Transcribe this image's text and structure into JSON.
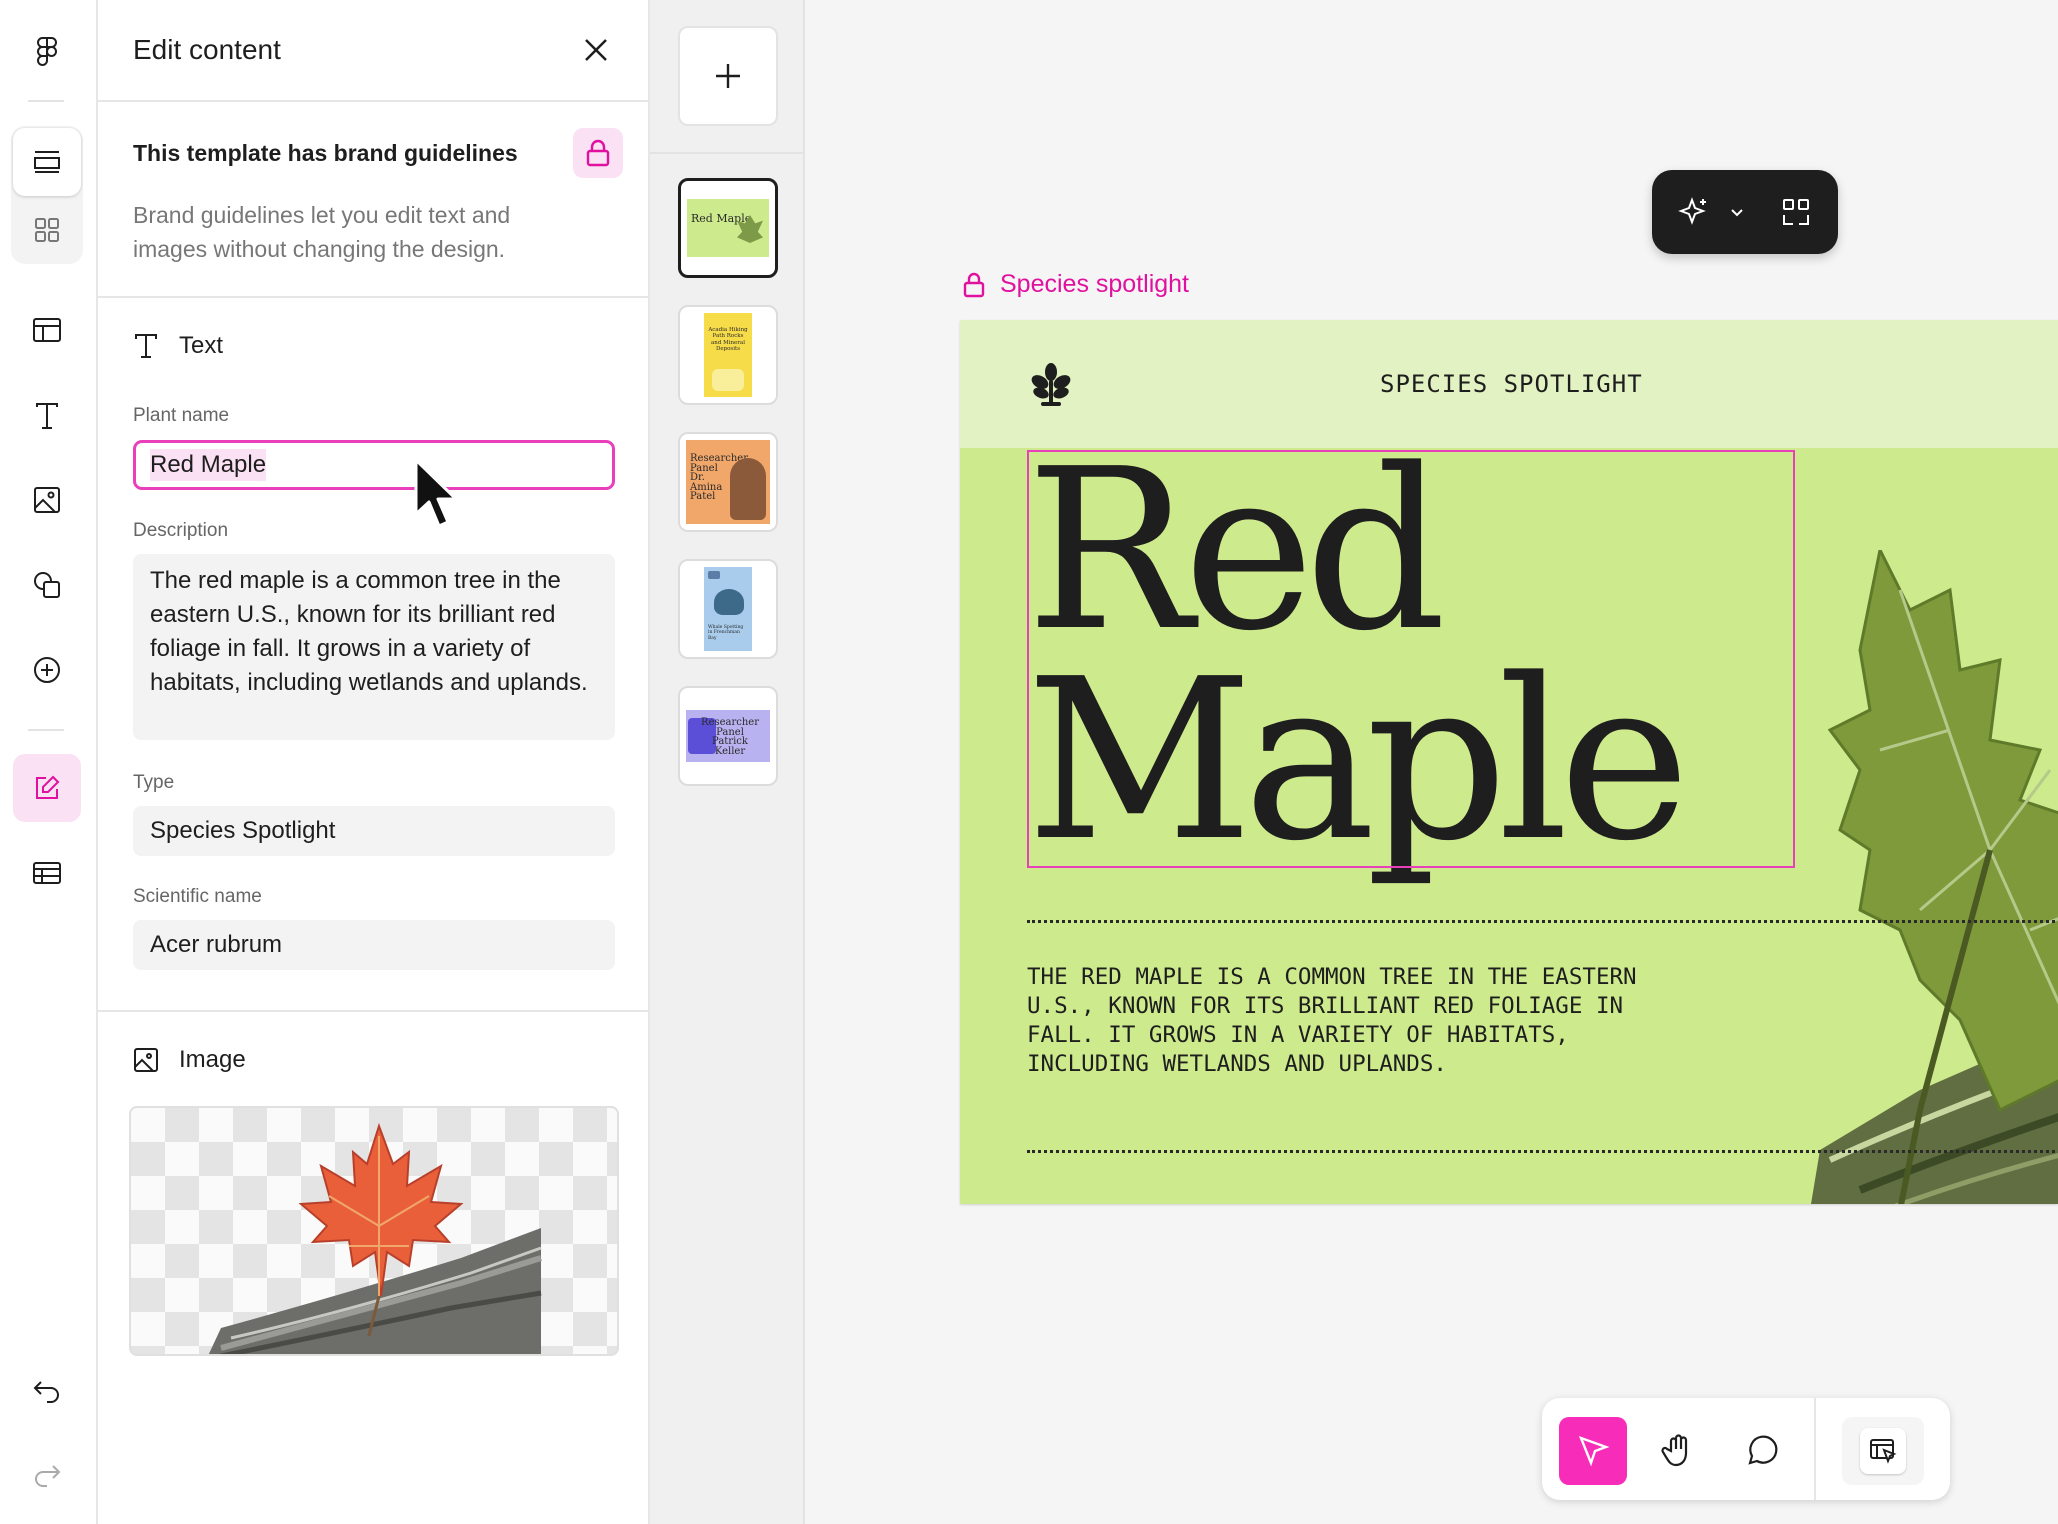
{
  "panel": {
    "title": "Edit content",
    "guidelines_title": "This template has brand guidelines",
    "guidelines_description": "Brand guidelines let you edit text and images without changing the design.",
    "text_section_label": "Text",
    "fields": {
      "plant_name": {
        "label": "Plant name",
        "value": "Red Maple"
      },
      "description": {
        "label": "Description",
        "value": "The red maple is a common tree in the eastern U.S., known for its brilliant red foliage in fall. It grows in a variety of habitats, including wetlands and uplands."
      },
      "type": {
        "label": "Type",
        "value": "Species Spotlight"
      },
      "scientific_name": {
        "label": "Scientific name",
        "value": "Acer rubrum"
      }
    },
    "image_section_label": "Image"
  },
  "thumbnails": [
    {
      "text": "Red Maple",
      "bg": "#cdea8c",
      "selected": true
    },
    {
      "text": "Acadia Hiking Path Rocks and Mineral Deposits",
      "bg": "#f7dc4a",
      "selected": false
    },
    {
      "text": "Researcher Panel Dr. Amina Patel",
      "bg": "#f2a76a",
      "selected": false
    },
    {
      "text": "Whale Spotting in Frenchman Bay",
      "bg": "#a9ccec",
      "selected": false
    },
    {
      "text": "Researcher Panel Patrick Keller",
      "bg": "#b9b2f0",
      "selected": false
    }
  ],
  "canvas": {
    "frame_label": "Species spotlight",
    "eyebrow": "SPECIES SPOTLIGHT",
    "title_line1": "Red",
    "title_line2": "Maple",
    "body": "THE RED MAPLE IS A COMMON TREE IN THE EASTERN U.S., KNOWN FOR ITS BRILLIANT RED FOLIAGE IN FALL. IT GROWS IN A VARIETY OF HABITATS, INCLUDING WETLANDS AND UPLANDS."
  },
  "colors": {
    "accent_pink": "#e93fba",
    "artboard_green": "#cdea8c",
    "artboard_header": "#e2f2c2",
    "toolbar_dark": "#1e1e1e"
  },
  "icons": {
    "rail": [
      "figma-logo-icon",
      "layers-icon",
      "assets-grid-icon",
      "layout-icon",
      "text-icon",
      "image-icon",
      "shapes-icon",
      "add-circle-icon",
      "edit-icon",
      "table-icon",
      "undo-icon",
      "redo-icon"
    ],
    "toolbar": [
      "ai-sparkle-icon",
      "chevron-down-icon",
      "frame-select-icon"
    ],
    "bottom_toolbar": [
      "move-cursor-icon",
      "hand-icon",
      "comment-icon",
      "dev-mode-icon"
    ]
  }
}
